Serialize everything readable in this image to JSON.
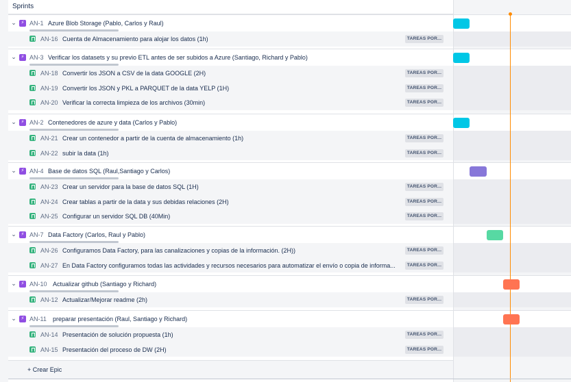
{
  "header": {
    "title": "Sprints"
  },
  "status_label": "TAREAS POR...",
  "create_epic_label": "+ Crear Epic",
  "colors": {
    "cyan": "#00c7e6",
    "purple": "#8777d9",
    "green": "#57d9a3",
    "orange": "#ff7452",
    "today": "#ff8b00"
  },
  "epics": [
    {
      "key": "AN-1",
      "summary": "Azure Blob Storage (Pablo, Carlos y Raul)",
      "bar_color": "cyan",
      "stories": [
        {
          "key": "AN-16",
          "summary": "Cuenta de Almacenamiento para alojar los datos (1h)"
        }
      ]
    },
    {
      "key": "AN-3",
      "summary": "Verificar los datasets y su previo ETL antes de ser subidos a Azure (Santiago, Richard y Pablo)",
      "bar_color": "cyan",
      "stories": [
        {
          "key": "AN-18",
          "summary": "Convertir los JSON a CSV de la data GOOGLE (2H)"
        },
        {
          "key": "AN-19",
          "summary": "Convertir los JSON y PKL a PARQUET de la data YELP (1H)"
        },
        {
          "key": "AN-20",
          "summary": "Verificar la correcta limpieza de los archivos (30min)"
        }
      ]
    },
    {
      "key": "AN-2",
      "summary": "Contenedores de azure y data (Carlos y Pablo)",
      "bar_color": "cyan",
      "stories": [
        {
          "key": "AN-21",
          "summary": "Crear un contenedor a partir de la cuenta de almacenamiento (1h)"
        },
        {
          "key": "AN-22",
          "summary": "subir la data (1h)"
        }
      ]
    },
    {
      "key": "AN-4",
      "summary": "Base de datos SQL (Raul,Santiago y Carlos)",
      "bar_color": "purple",
      "stories": [
        {
          "key": "AN-23",
          "summary": "Crear un servidor para la base de datos SQL (1H)"
        },
        {
          "key": "AN-24",
          "summary": "Crear tablas a partir de la data y sus debidas relaciones (2H)"
        },
        {
          "key": "AN-25",
          "summary": "Configurar un servidor SQL DB (40Min)"
        }
      ]
    },
    {
      "key": "AN-7",
      "summary": "Data Factory (Carlos, Raul y Pablo)",
      "bar_color": "green",
      "stories": [
        {
          "key": "AN-26",
          "summary": "Configuramos Data Factory, para las canalizaciones y copias de la información. (2H))"
        },
        {
          "key": "AN-27",
          "summary": "En Data Factory configuramos todas las actividades y recursos necesarios para automatizar el envío o copia de informa..."
        }
      ]
    },
    {
      "key": "AN-10",
      "summary": "Actualizar github (Santiago y Richard)",
      "bar_color": "orange",
      "stories": [
        {
          "key": "AN-12",
          "summary": "Actualizar/Mejorar readme (2h)"
        }
      ]
    },
    {
      "key": "AN-11",
      "summary": "preparar presentación (Raul, Santiago y Richard)",
      "bar_color": "orange",
      "stories": [
        {
          "key": "AN-14",
          "summary": "Presentación de solución propuesta (1h)"
        },
        {
          "key": "AN-15",
          "summary": "Presentación del proceso de DW (2H)"
        }
      ]
    }
  ]
}
